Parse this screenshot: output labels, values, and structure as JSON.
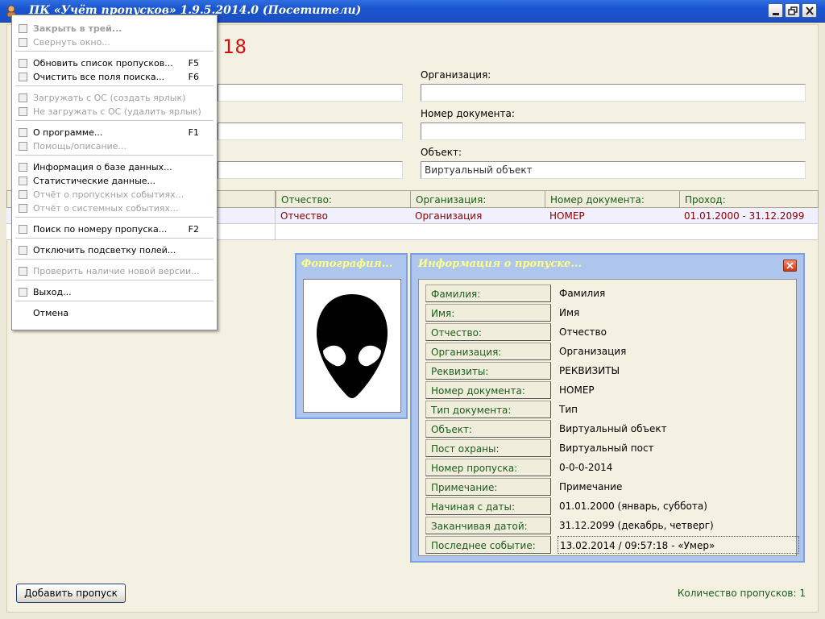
{
  "window": {
    "title": "ПК «Учёт пропусков» 1.9.5.2014.0  (Посетители)",
    "counter": "18"
  },
  "search": {
    "organization_label": "Организация:",
    "organization_value": "",
    "document_label": "Номер документа:",
    "document_value": "",
    "object_label": "Объект:",
    "object_placeholder": "Виртуальный объект"
  },
  "grid": {
    "headers": [
      "Отчество:",
      "Организация:",
      "Номер документа:",
      "Проход:"
    ],
    "row": [
      "Отчество",
      "Организация",
      "НОМЕР",
      "01.01.2000 - 31.12.2099"
    ]
  },
  "photo_panel": {
    "title": "Фотография..."
  },
  "info_panel": {
    "title": "Информация о пропуске...",
    "rows": [
      {
        "label": "Фамилия:",
        "value": "Фамилия"
      },
      {
        "label": "Имя:",
        "value": "Имя"
      },
      {
        "label": "Отчество:",
        "value": "Отчество"
      },
      {
        "label": "Организация:",
        "value": "Организация"
      },
      {
        "label": "Реквизиты:",
        "value": "РЕКВИЗИТЫ"
      },
      {
        "label": "Номер документа:",
        "value": "НОМЕР"
      },
      {
        "label": "Тип документа:",
        "value": "Тип"
      },
      {
        "label": "Объект:",
        "value": "Виртуальный объект"
      },
      {
        "label": "Пост охраны:",
        "value": "Виртуальный пост"
      },
      {
        "label": "Номер пропуска:",
        "value": "0-0-0-2014"
      },
      {
        "label": "Примечание:",
        "value": "Примечание"
      },
      {
        "label": "Начиная с даты:",
        "value": "01.01.2000  (январь, суббота)"
      },
      {
        "label": "Заканчивая датой:",
        "value": "31.12.2099  (декабрь, четверг)"
      },
      {
        "label": "Последнее событие:",
        "value": "13.02.2014 / 09:57:18 - «Умер»"
      }
    ]
  },
  "bottom": {
    "add_button": "Добавить пропуск",
    "status": "Количество пропусков: 1"
  },
  "menu": {
    "items": [
      {
        "label": "Закрыть в трей...",
        "key": "",
        "disabled": true,
        "bold": true
      },
      {
        "label": "Свернуть окно...",
        "key": "",
        "disabled": true
      },
      {
        "label": "Обновить список пропусков...",
        "key": "F5",
        "disabled": false
      },
      {
        "label": "Очистить все поля поиска...",
        "key": "F6",
        "disabled": false
      },
      {
        "label": "Загружать с ОС (создать ярлык)",
        "key": "",
        "disabled": true
      },
      {
        "label": "Не загружать с ОС (удалить ярлык)",
        "key": "",
        "disabled": true
      },
      {
        "label": "О программе...",
        "key": "F1",
        "disabled": false
      },
      {
        "label": "Помощь/описание...",
        "key": "",
        "disabled": true
      },
      {
        "label": "Информация о базе данных...",
        "key": "",
        "disabled": false
      },
      {
        "label": "Статистические данные...",
        "key": "",
        "disabled": false
      },
      {
        "label": "Отчёт о пропускных событиях...",
        "key": "",
        "disabled": true
      },
      {
        "label": "Отчёт о системных событиях...",
        "key": "",
        "disabled": true
      },
      {
        "label": "Поиск по номеру пропуска...",
        "key": "F2",
        "disabled": false
      },
      {
        "label": "Отключить подсветку полей...",
        "key": "",
        "disabled": false
      },
      {
        "label": "Проверить наличие новой версии...",
        "key": "",
        "disabled": true
      },
      {
        "label": "Выход...",
        "key": "",
        "disabled": false
      },
      {
        "label": "Отмена",
        "key": "",
        "disabled": false
      }
    ]
  }
}
